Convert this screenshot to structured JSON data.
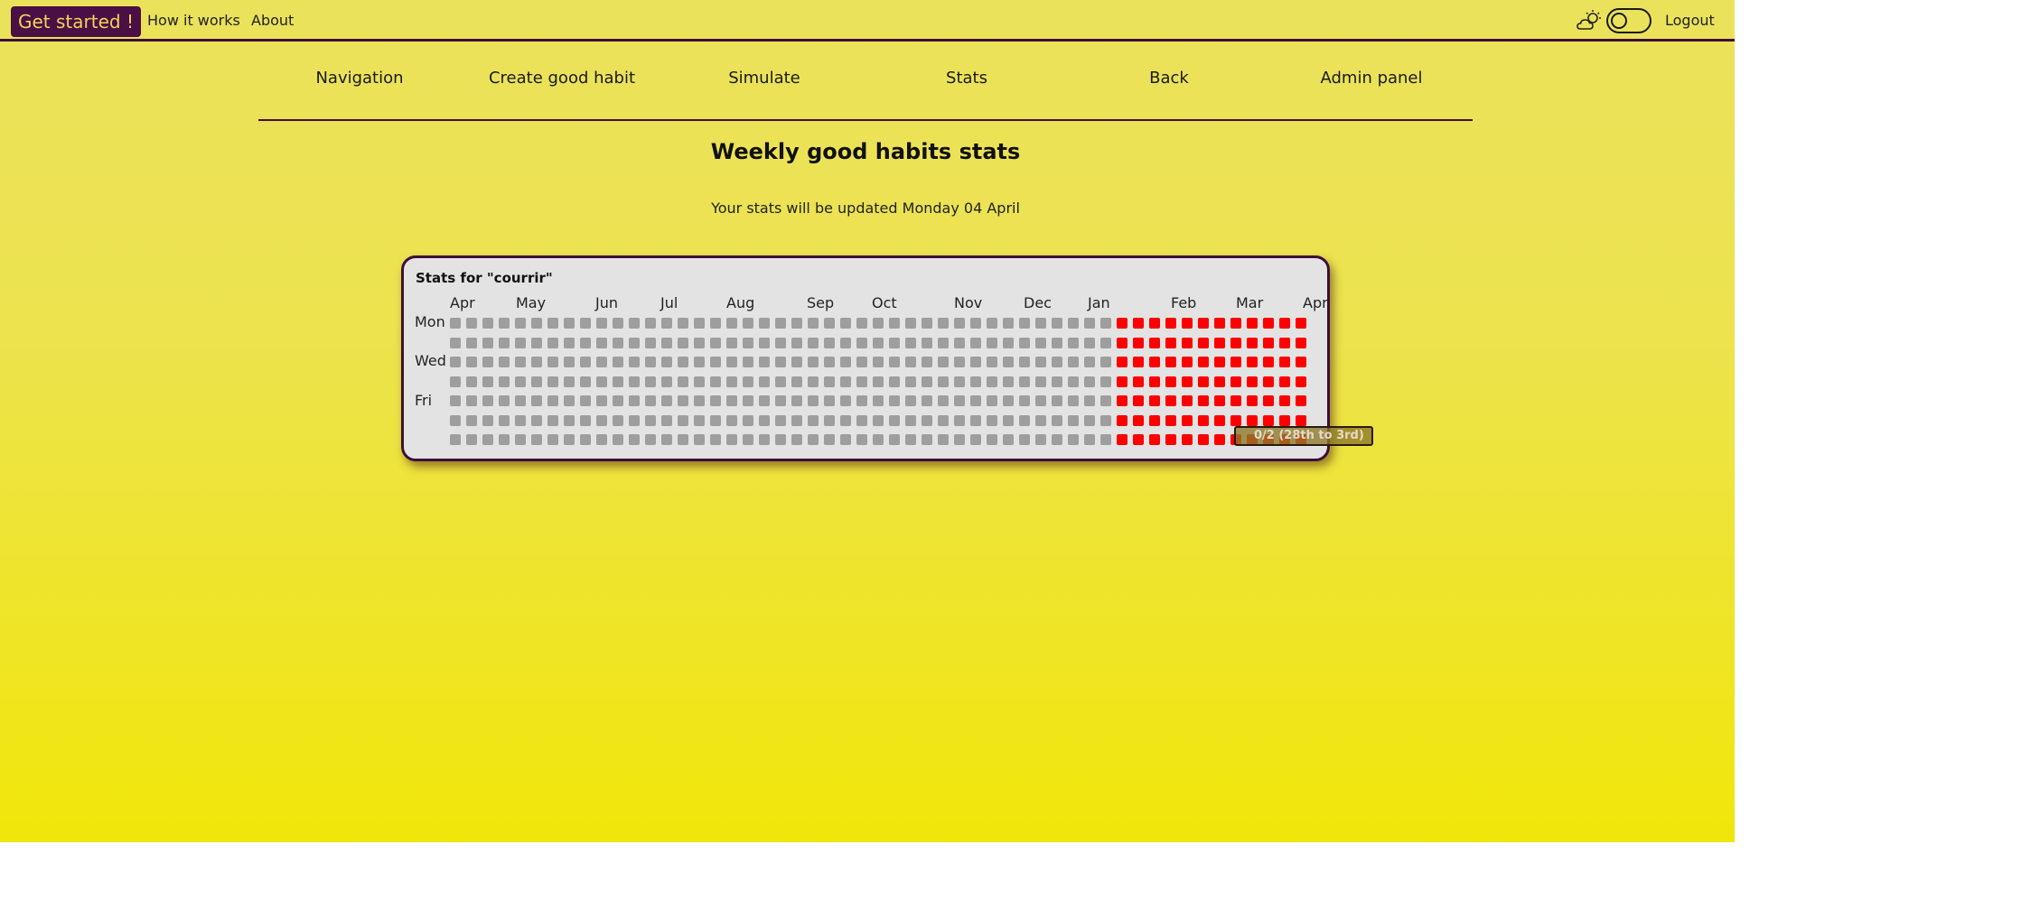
{
  "topbar": {
    "cta_label": "Get started !",
    "links": [
      "How it works",
      "About"
    ],
    "logout_label": "Logout",
    "icons": {
      "weather": "cloud-sun-icon"
    }
  },
  "nav": {
    "items": [
      "Navigation",
      "Create good habit",
      "Simulate",
      "Stats",
      "Back",
      "Admin panel"
    ]
  },
  "page": {
    "title": "Weekly good habits stats",
    "update_text": "Your stats will be updated Monday 04 April"
  },
  "stats": {
    "title": "Stats for \"courrir\"",
    "months": [
      "Apr",
      "May",
      "Jun",
      "Jul",
      "Aug",
      "Sep",
      "Oct",
      "Nov",
      "Dec",
      "Jan",
      "Feb",
      "Mar",
      "Apr"
    ],
    "days": [
      "Mon",
      "Wed",
      "Fri"
    ],
    "weeks": 53,
    "rows": 7,
    "first_active_week": 41,
    "colors": {
      "inactive": "#9e9e9e",
      "active": "#ff0000"
    },
    "tooltip": "0/2 (28th to 3rd)"
  },
  "colors": {
    "brand": "#4a0f45",
    "accent_text": "#f0d35a",
    "background_top": "#ebe25c",
    "background_bottom": "#f1e60a"
  }
}
